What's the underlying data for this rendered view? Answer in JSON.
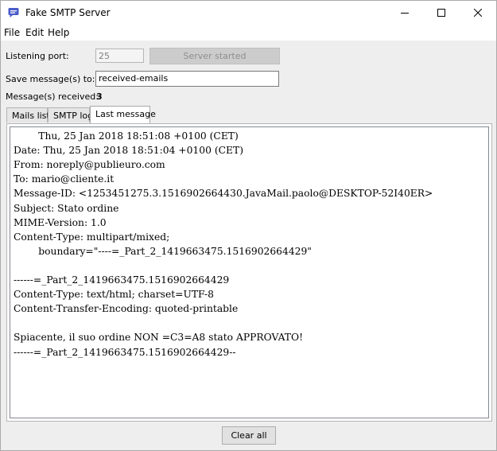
{
  "window": {
    "title": "Fake SMTP Server"
  },
  "menu": [
    "File",
    "Edit",
    "Help"
  ],
  "form": {
    "port_label": "Listening port:",
    "port_value": "25",
    "start_button": "Server started",
    "save_label": "Save message(s) to:",
    "save_value": "received-emails",
    "received_label": "Message(s) received:",
    "received_count": "3"
  },
  "tabs": [
    "Mails list",
    "SMTP log",
    "Last message"
  ],
  "active_tab": "Last message",
  "message_lines": [
    "        Thu, 25 Jan 2018 18:51:08 +0100 (CET)",
    "Date: Thu, 25 Jan 2018 18:51:04 +0100 (CET)",
    "From: noreply@publieuro.com",
    "To: mario@cliente.it",
    "Message-ID: <1253451275.3.1516902664430.JavaMail.paolo@DESKTOP-52I40ER>",
    "Subject: Stato ordine",
    "MIME-Version: 1.0",
    "Content-Type: multipart/mixed;",
    "        boundary=\"----=_Part_2_1419663475.1516902664429\"",
    "",
    "------=_Part_2_1419663475.1516902664429",
    "Content-Type: text/html; charset=UTF-8",
    "Content-Transfer-Encoding: quoted-printable",
    "",
    "Spiacente, il suo ordine NON =C3=A8 stato APPROVATO!",
    "------=_Part_2_1419663475.1516902664429--"
  ],
  "clear_button": "Clear all",
  "icons": {
    "app": "speech-bubble-icon",
    "minimize": "minimize-icon",
    "maximize": "maximize-icon",
    "close": "close-icon"
  },
  "colors": {
    "app_icon": "#4a5cc8",
    "disabled_button": "#cccccc"
  }
}
